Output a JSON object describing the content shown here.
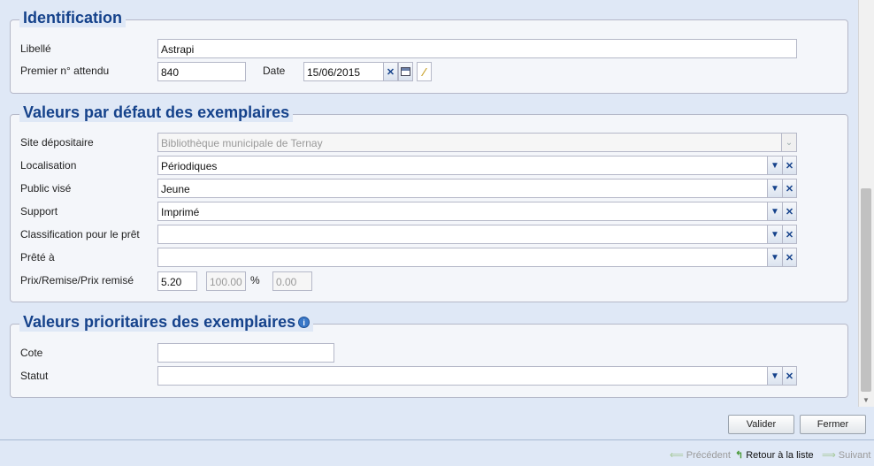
{
  "identification": {
    "legend": "Identification",
    "libelle_label": "Libellé",
    "libelle_value": "Astrapi",
    "premier_label": "Premier n° attendu",
    "premier_value": "840",
    "date_label": "Date",
    "date_value": "15/06/2015"
  },
  "defaults": {
    "legend": "Valeurs par défaut des exemplaires",
    "site_label": "Site dépositaire",
    "site_value": "Bibliothèque municipale de Ternay",
    "localisation_label": "Localisation",
    "localisation_value": "Périodiques",
    "public_label": "Public visé",
    "public_value": "Jeune",
    "support_label": "Support",
    "support_value": "Imprimé",
    "classification_label": "Classification pour le prêt",
    "classification_value": "",
    "prete_label": "Prêté à",
    "prete_value": "",
    "prix_label": "Prix/Remise/Prix remisé",
    "prix_value": "5.20",
    "remise_value": "100.00",
    "percent": "%",
    "prix_remise_value": "0.00"
  },
  "priority": {
    "legend": "Valeurs prioritaires des exemplaires",
    "cote_label": "Cote",
    "cote_value": "",
    "statut_label": "Statut",
    "statut_value": ""
  },
  "actions": {
    "valider": "Valider",
    "fermer": "Fermer"
  },
  "footer": {
    "precedent": "Précédent",
    "retour": "Retour à la liste",
    "suivant": "Suivant"
  },
  "icons": {
    "clear": "close-icon",
    "dropdown": "chevron-down-icon",
    "calendar": "calendar-icon",
    "wand": "magic-wand-icon",
    "info": "info-icon"
  },
  "colors": {
    "legend": "#15428b",
    "panel_bg": "#dfe8f6",
    "fieldset_bg": "#f4f6fa"
  }
}
